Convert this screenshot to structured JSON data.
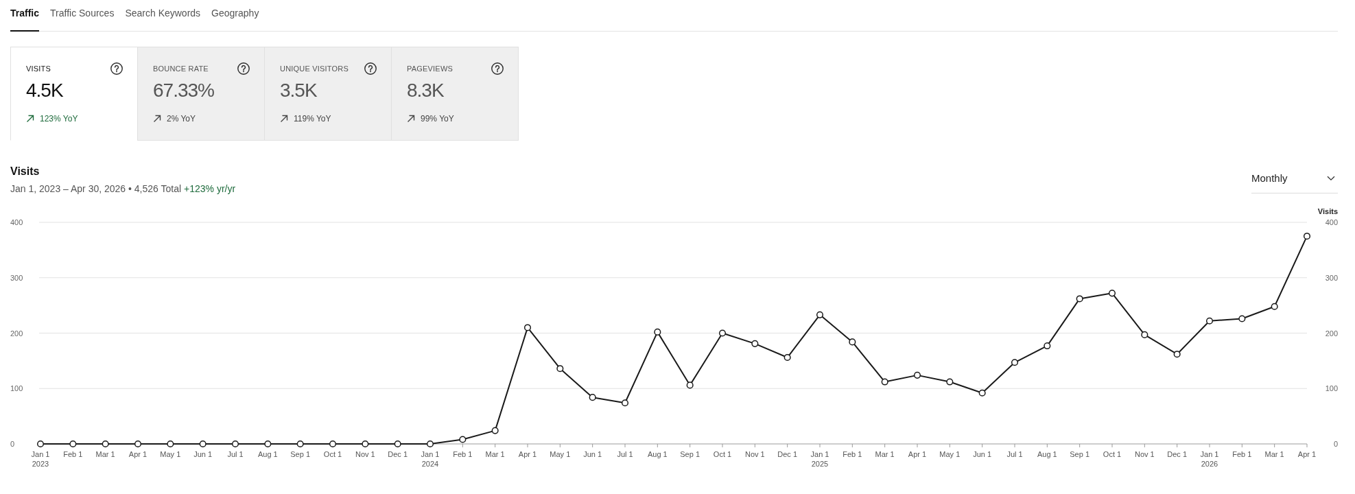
{
  "tabs": [
    {
      "label": "Traffic",
      "selected": true
    },
    {
      "label": "Traffic Sources",
      "selected": false
    },
    {
      "label": "Search Keywords",
      "selected": false
    },
    {
      "label": "Geography",
      "selected": false
    }
  ],
  "metrics": [
    {
      "label": "VISITS",
      "value": "4.5K",
      "change": "123% YoY",
      "selected": true
    },
    {
      "label": "BOUNCE RATE",
      "value": "67.33%",
      "change": "2% YoY",
      "selected": false
    },
    {
      "label": "UNIQUE VISITORS",
      "value": "3.5K",
      "change": "119% YoY",
      "selected": false
    },
    {
      "label": "PAGEVIEWS",
      "value": "8.3K",
      "change": "99% YoY",
      "selected": false
    }
  ],
  "visits": {
    "title": "Visits",
    "summary": "Jan 1, 2023 – Apr 30, 2026 • 4,526 Total",
    "change": "+123% yr/yr",
    "interval": "Monthly",
    "chart_data": {
      "type": "line",
      "grid": true,
      "categories": [
        "Jan 1\n2023",
        "Feb 1",
        "Mar 1",
        "Apr 1",
        "May 1",
        "Jun 1",
        "Jul 1",
        "Aug 1",
        "Sep 1",
        "Oct 1",
        "Nov 1",
        "Dec 1",
        "Jan 1\n2024",
        "Feb 1",
        "Mar 1",
        "Apr 1",
        "May 1",
        "Jun 1",
        "Jul 1",
        "Aug 1",
        "Sep 1",
        "Oct 1",
        "Nov 1",
        "Dec 1",
        "Jan 1\n2025",
        "Feb 1",
        "Mar 1",
        "Apr 1",
        "May 1",
        "Jun 1",
        "Jul 1",
        "Aug 1",
        "Sep 1",
        "Oct 1",
        "Nov 1",
        "Dec 1",
        "Jan 1\n2026",
        "Feb 1",
        "Mar 1",
        "Apr 1"
      ],
      "series": [
        {
          "name": "Visits",
          "color": "#1a1a1a",
          "marker": "circle",
          "values": [
            0,
            0,
            0,
            0,
            0,
            0,
            0,
            0,
            0,
            0,
            0,
            0,
            0,
            8,
            24,
            210,
            136,
            84,
            74,
            202,
            106,
            200,
            181,
            156,
            233,
            184,
            112,
            124,
            112,
            92,
            147,
            177,
            262,
            272,
            197,
            162,
            222,
            226,
            248,
            375
          ]
        }
      ],
      "ylim": [
        0,
        400
      ],
      "yticks": [
        0,
        100,
        200,
        300,
        400
      ],
      "y2lim": [
        0,
        400
      ],
      "y2ticks": [
        0,
        100,
        200,
        300,
        400
      ]
    }
  }
}
